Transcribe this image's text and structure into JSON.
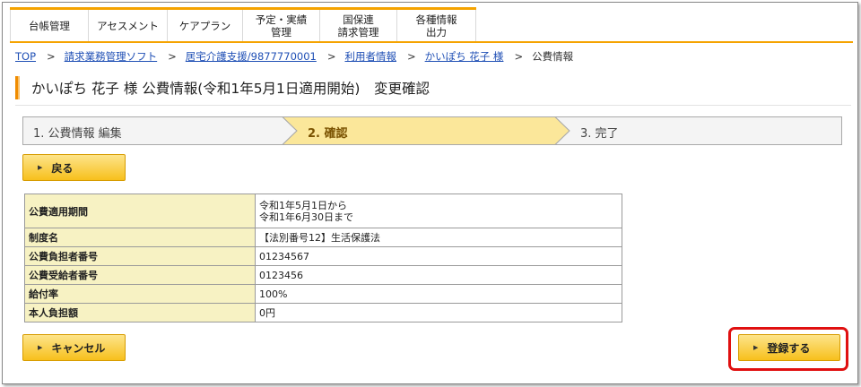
{
  "nav": {
    "items": [
      {
        "label": "台帳管理"
      },
      {
        "label": "アセスメント"
      },
      {
        "label": "ケアプラン"
      },
      {
        "label": "予定・実績\n管理"
      },
      {
        "label": "国保連\n請求管理"
      },
      {
        "label": "各種情報\n出力"
      }
    ]
  },
  "breadcrumb": {
    "links": [
      "TOP",
      "請求業務管理ソフト",
      "居宅介護支援/9877770001",
      "利用者情報",
      "かいぽち 花子 様"
    ],
    "separator": ">",
    "current": "公費情報"
  },
  "page": {
    "title": "かいぽち 花子 様 公費情報(令和1年5月1日適用開始)　変更確認"
  },
  "steps": [
    {
      "label": "1. 公費情報 編集",
      "active": false
    },
    {
      "label": "2. 確認",
      "active": true
    },
    {
      "label": "3. 完了",
      "active": false
    }
  ],
  "buttons": {
    "back": "戻る",
    "cancel": "キャンセル",
    "register": "登録する"
  },
  "table": {
    "rows": [
      {
        "key": "公費適用期間",
        "value": "令和1年5月1日から\n令和1年6月30日まで"
      },
      {
        "key": "制度名",
        "value": "【法別番号12】生活保護法"
      },
      {
        "key": "公費負担者番号",
        "value": "01234567"
      },
      {
        "key": "公費受給者番号",
        "value": "0123456"
      },
      {
        "key": "給付率",
        "value": "100%"
      },
      {
        "key": "本人負担額",
        "value": "0円"
      }
    ]
  },
  "colors": {
    "accent": "#f5a300",
    "step_active": "#fbe79a",
    "step_inactive": "#f4f4f4",
    "table_key": "#f7f2c3",
    "highlight": "#e01010",
    "link": "#1f4fb5"
  }
}
